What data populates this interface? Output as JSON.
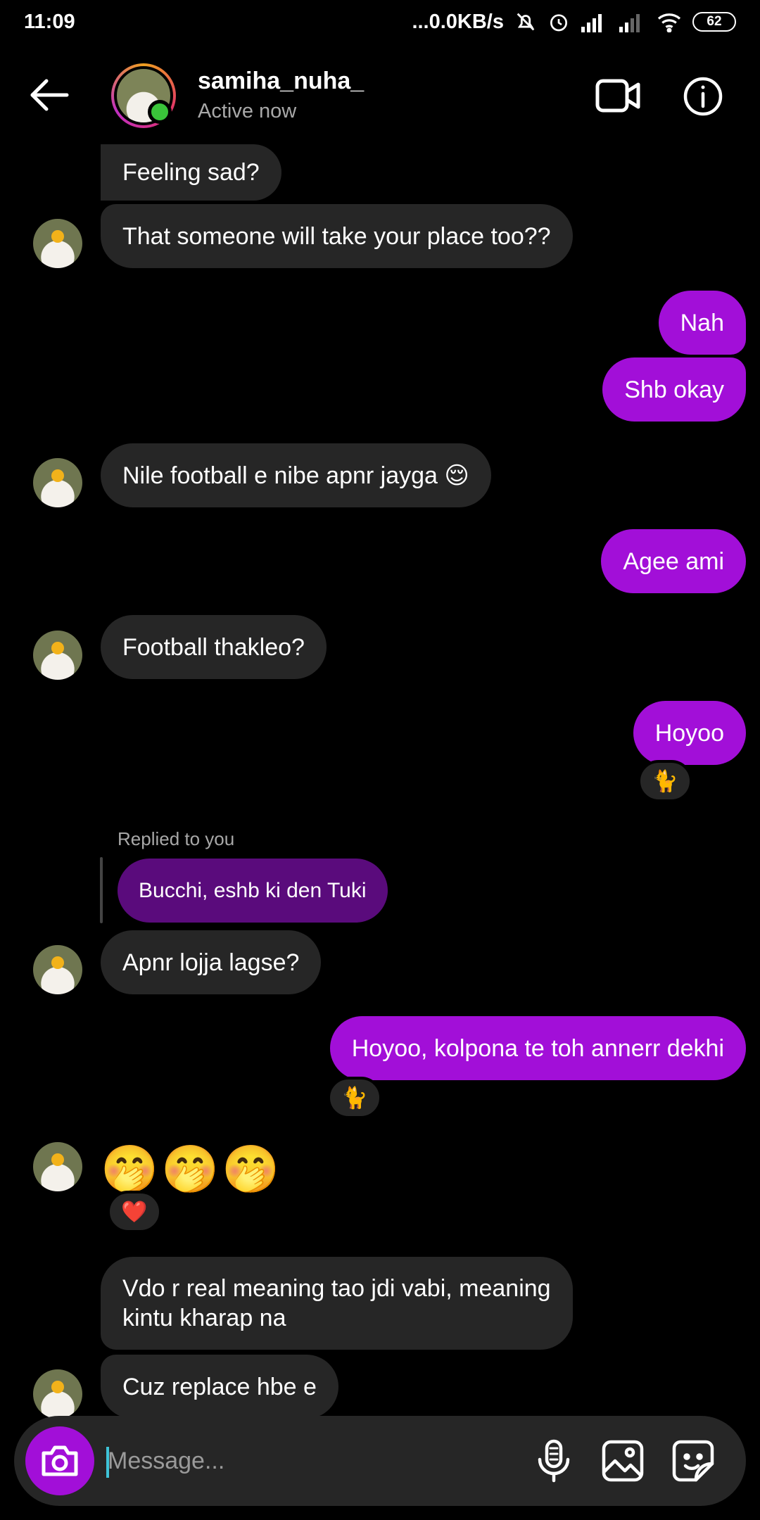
{
  "status_bar": {
    "time": "11:09",
    "network_speed": "...0.0KB/s",
    "battery": "62"
  },
  "header": {
    "username": "samiha_nuha_",
    "status": "Active now"
  },
  "messages": [
    {
      "text": "Feeling sad?",
      "from": "them"
    },
    {
      "text": "That someone will take your place too??",
      "from": "them"
    },
    {
      "text": "Nah",
      "from": "me"
    },
    {
      "text": "Shb okay",
      "from": "me"
    },
    {
      "text": "Nile football e nibe apnr jayga 😌",
      "from": "them"
    },
    {
      "text": "Agee ami",
      "from": "me"
    },
    {
      "text": "Football thakleo?",
      "from": "them"
    },
    {
      "text": "Hoyoo",
      "from": "me",
      "reaction": "🐈"
    },
    {
      "text": "Apnr lojja lagse?",
      "from": "them",
      "reply_label": "Replied to you",
      "reply_text": "Bucchi, eshb ki den Tuki"
    },
    {
      "text": "Hoyoo, kolpona te toh annerr dekhi",
      "from": "me",
      "reaction": "🐈"
    },
    {
      "text": "🤭🤭🤭",
      "from": "them",
      "reaction": "❤️"
    },
    {
      "text": "Vdo r real meaning tao jdi vabi, meaning",
      "text2": "kintu kharap na",
      "from": "them"
    },
    {
      "text": "Cuz replace hbe e",
      "from": "them"
    }
  ],
  "composer": {
    "placeholder": "Message..."
  },
  "colors": {
    "accent": "#a20fd8",
    "incoming_bubble": "#262626",
    "reply_bubble": "#5a0b7c",
    "online": "#3ac43a"
  },
  "icons": [
    "back-arrow-icon",
    "video-call-icon",
    "info-icon",
    "camera-icon",
    "microphone-icon",
    "gallery-icon",
    "sticker-icon"
  ]
}
